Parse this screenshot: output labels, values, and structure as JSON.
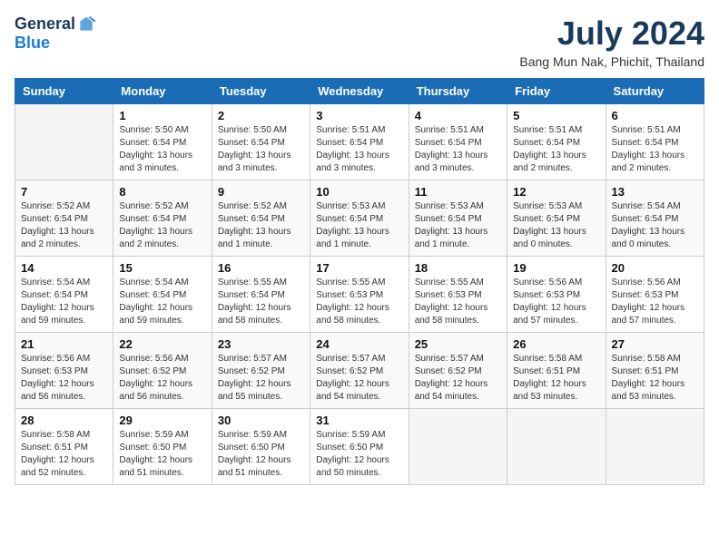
{
  "logo": {
    "general": "General",
    "blue": "Blue"
  },
  "title": "July 2024",
  "location": "Bang Mun Nak, Phichit, Thailand",
  "days_of_week": [
    "Sunday",
    "Monday",
    "Tuesday",
    "Wednesday",
    "Thursday",
    "Friday",
    "Saturday"
  ],
  "weeks": [
    [
      {
        "day": "",
        "info": ""
      },
      {
        "day": "1",
        "info": "Sunrise: 5:50 AM\nSunset: 6:54 PM\nDaylight: 13 hours and 3 minutes."
      },
      {
        "day": "2",
        "info": "Sunrise: 5:50 AM\nSunset: 6:54 PM\nDaylight: 13 hours and 3 minutes."
      },
      {
        "day": "3",
        "info": "Sunrise: 5:51 AM\nSunset: 6:54 PM\nDaylight: 13 hours and 3 minutes."
      },
      {
        "day": "4",
        "info": "Sunrise: 5:51 AM\nSunset: 6:54 PM\nDaylight: 13 hours and 3 minutes."
      },
      {
        "day": "5",
        "info": "Sunrise: 5:51 AM\nSunset: 6:54 PM\nDaylight: 13 hours and 2 minutes."
      },
      {
        "day": "6",
        "info": "Sunrise: 5:51 AM\nSunset: 6:54 PM\nDaylight: 13 hours and 2 minutes."
      }
    ],
    [
      {
        "day": "7",
        "info": "Sunrise: 5:52 AM\nSunset: 6:54 PM\nDaylight: 13 hours and 2 minutes."
      },
      {
        "day": "8",
        "info": "Sunrise: 5:52 AM\nSunset: 6:54 PM\nDaylight: 13 hours and 2 minutes."
      },
      {
        "day": "9",
        "info": "Sunrise: 5:52 AM\nSunset: 6:54 PM\nDaylight: 13 hours and 1 minute."
      },
      {
        "day": "10",
        "info": "Sunrise: 5:53 AM\nSunset: 6:54 PM\nDaylight: 13 hours and 1 minute."
      },
      {
        "day": "11",
        "info": "Sunrise: 5:53 AM\nSunset: 6:54 PM\nDaylight: 13 hours and 1 minute."
      },
      {
        "day": "12",
        "info": "Sunrise: 5:53 AM\nSunset: 6:54 PM\nDaylight: 13 hours and 0 minutes."
      },
      {
        "day": "13",
        "info": "Sunrise: 5:54 AM\nSunset: 6:54 PM\nDaylight: 13 hours and 0 minutes."
      }
    ],
    [
      {
        "day": "14",
        "info": "Sunrise: 5:54 AM\nSunset: 6:54 PM\nDaylight: 12 hours and 59 minutes."
      },
      {
        "day": "15",
        "info": "Sunrise: 5:54 AM\nSunset: 6:54 PM\nDaylight: 12 hours and 59 minutes."
      },
      {
        "day": "16",
        "info": "Sunrise: 5:55 AM\nSunset: 6:54 PM\nDaylight: 12 hours and 58 minutes."
      },
      {
        "day": "17",
        "info": "Sunrise: 5:55 AM\nSunset: 6:53 PM\nDaylight: 12 hours and 58 minutes."
      },
      {
        "day": "18",
        "info": "Sunrise: 5:55 AM\nSunset: 6:53 PM\nDaylight: 12 hours and 58 minutes."
      },
      {
        "day": "19",
        "info": "Sunrise: 5:56 AM\nSunset: 6:53 PM\nDaylight: 12 hours and 57 minutes."
      },
      {
        "day": "20",
        "info": "Sunrise: 5:56 AM\nSunset: 6:53 PM\nDaylight: 12 hours and 57 minutes."
      }
    ],
    [
      {
        "day": "21",
        "info": "Sunrise: 5:56 AM\nSunset: 6:53 PM\nDaylight: 12 hours and 56 minutes."
      },
      {
        "day": "22",
        "info": "Sunrise: 5:56 AM\nSunset: 6:52 PM\nDaylight: 12 hours and 56 minutes."
      },
      {
        "day": "23",
        "info": "Sunrise: 5:57 AM\nSunset: 6:52 PM\nDaylight: 12 hours and 55 minutes."
      },
      {
        "day": "24",
        "info": "Sunrise: 5:57 AM\nSunset: 6:52 PM\nDaylight: 12 hours and 54 minutes."
      },
      {
        "day": "25",
        "info": "Sunrise: 5:57 AM\nSunset: 6:52 PM\nDaylight: 12 hours and 54 minutes."
      },
      {
        "day": "26",
        "info": "Sunrise: 5:58 AM\nSunset: 6:51 PM\nDaylight: 12 hours and 53 minutes."
      },
      {
        "day": "27",
        "info": "Sunrise: 5:58 AM\nSunset: 6:51 PM\nDaylight: 12 hours and 53 minutes."
      }
    ],
    [
      {
        "day": "28",
        "info": "Sunrise: 5:58 AM\nSunset: 6:51 PM\nDaylight: 12 hours and 52 minutes."
      },
      {
        "day": "29",
        "info": "Sunrise: 5:59 AM\nSunset: 6:50 PM\nDaylight: 12 hours and 51 minutes."
      },
      {
        "day": "30",
        "info": "Sunrise: 5:59 AM\nSunset: 6:50 PM\nDaylight: 12 hours and 51 minutes."
      },
      {
        "day": "31",
        "info": "Sunrise: 5:59 AM\nSunset: 6:50 PM\nDaylight: 12 hours and 50 minutes."
      },
      {
        "day": "",
        "info": ""
      },
      {
        "day": "",
        "info": ""
      },
      {
        "day": "",
        "info": ""
      }
    ]
  ]
}
